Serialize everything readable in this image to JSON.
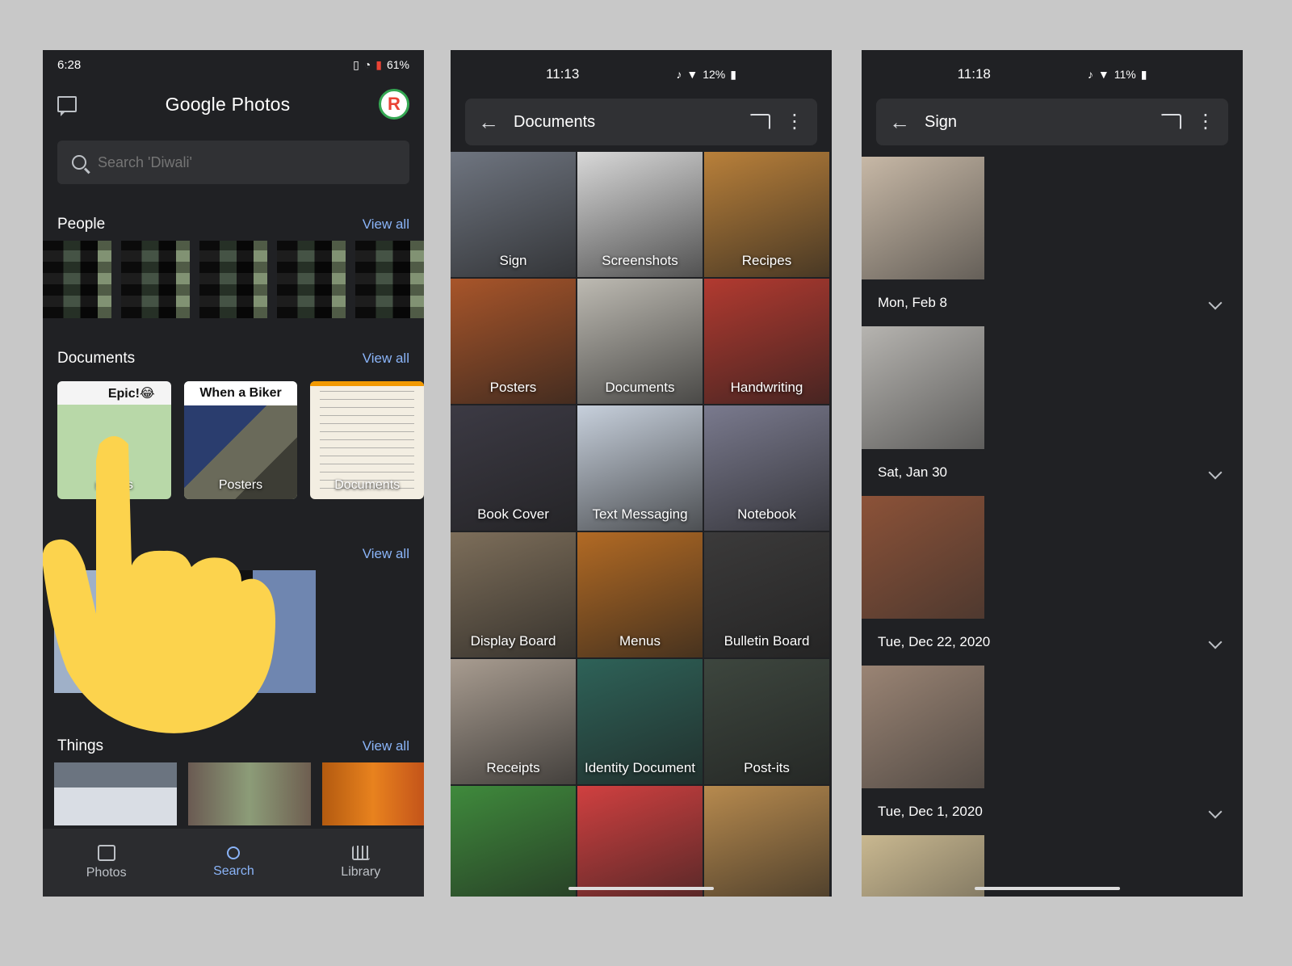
{
  "panel1": {
    "status": {
      "time": "6:28",
      "battery": "61%"
    },
    "app_title": "Google Photos",
    "avatar_letter": "R",
    "search_placeholder": "Search 'Diwali'",
    "sections": {
      "people": {
        "title": "People",
        "view_all": "View all"
      },
      "documents": {
        "title": "Documents",
        "view_all": "View all"
      },
      "places": {
        "title": "Pl",
        "view_all": "View all"
      },
      "things": {
        "title": "Things",
        "view_all": "View all"
      }
    },
    "doc_cards": [
      {
        "top": "Epic!😂",
        "caption": "nshots"
      },
      {
        "top": "When a Biker",
        "caption": "Posters"
      },
      {
        "top": "",
        "caption": "Documents"
      }
    ],
    "nav": [
      "Photos",
      "Search",
      "Library"
    ]
  },
  "panel2": {
    "status": {
      "time": "11:13",
      "battery": "12%"
    },
    "title": "Documents",
    "tiles": [
      {
        "label": "Sign",
        "color": "#6f7580"
      },
      {
        "label": "Screenshots",
        "color": "#d8d8d8"
      },
      {
        "label": "Recipes",
        "color": "#b9803a"
      },
      {
        "label": "Posters",
        "color": "#a8552a"
      },
      {
        "label": "Documents",
        "color": "#bdbab2"
      },
      {
        "label": "Handwriting",
        "color": "#b23a30"
      },
      {
        "label": "Book Cover",
        "color": "#3c3a44"
      },
      {
        "label": "Text Messaging",
        "color": "#c7d0dc"
      },
      {
        "label": "Notebook",
        "color": "#7a7a8e"
      },
      {
        "label": "Display Board",
        "color": "#7d6e5a"
      },
      {
        "label": "Menus",
        "color": "#b26a24"
      },
      {
        "label": "Bulletin Board",
        "color": "#3b3a3a"
      },
      {
        "label": "Receipts",
        "color": "#a89c90"
      },
      {
        "label": "Identity Document",
        "color": "#2e6258"
      },
      {
        "label": "Post-its",
        "color": "#3d463e"
      },
      {
        "label": "",
        "color": "#3f8a3c"
      },
      {
        "label": "",
        "color": "#d04040"
      },
      {
        "label": "",
        "color": "#b78a4e"
      }
    ]
  },
  "panel3": {
    "status": {
      "time": "11:18",
      "battery": "11%"
    },
    "title": "Sign",
    "entries": [
      {
        "date": "",
        "thumb_color": "#c7b8a6"
      },
      {
        "date": "Mon, Feb 8",
        "thumb_color": "#b6b4b0"
      },
      {
        "date": "Sat, Jan 30",
        "thumb_color": "#8c5238"
      },
      {
        "date": "Tue, Dec 22, 2020",
        "thumb_color": "#9a8474"
      },
      {
        "date": "Tue, Dec 1, 2020",
        "thumb_color": "#c9b890"
      }
    ]
  }
}
